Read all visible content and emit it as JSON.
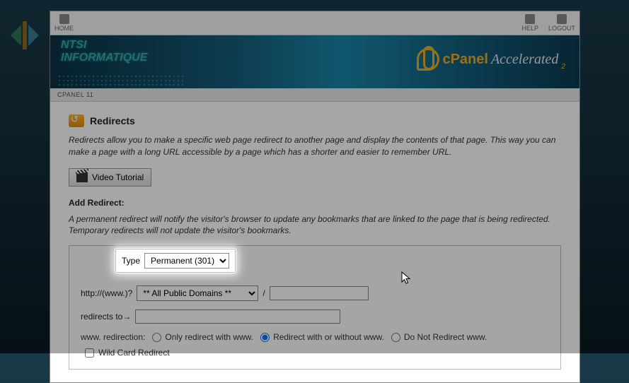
{
  "nav": {
    "home": "HOME",
    "help": "HELP",
    "logout": "LOGOUT"
  },
  "banner": {
    "line1": "NTSI",
    "line2": "INFORMATIQUE",
    "brand_prefix": "cPanel",
    "brand_suffix": "Accelerated",
    "brand_sub": "2"
  },
  "breadcrumb": "CPANEL 11",
  "page": {
    "title": "Redirects",
    "intro": "Redirects allow you to make a specific web page redirect to another page and display the contents of that page. This way you can make a page with a long URL accessible by a page which has a shorter and easier to remember URL.",
    "video_button": "Video Tutorial",
    "add_heading": "Add Redirect:",
    "add_intro": "A permanent redirect will notify the visitor's browser to update any bookmarks that are linked to the page that is being redirected. Temporary redirects will not update the visitor's bookmarks."
  },
  "form": {
    "type_label": "Type",
    "type_value": "Permanent (301)",
    "domain_label": "http://(www.)?",
    "domain_value": "** All Public Domains **",
    "path_sep": "/",
    "path_value": "",
    "dest_label": "redirects to→",
    "dest_value": "",
    "www_label": "www. redirection:",
    "www_opt1": "Only redirect with www.",
    "www_opt2": "Redirect with or without www.",
    "www_opt3": "Do Not Redirect www.",
    "www_selected": "opt2",
    "wildcard_label": "Wild Card Redirect",
    "wildcard_checked": false
  },
  "highlight": {
    "label": "Type",
    "value": "Permanent (301)"
  }
}
